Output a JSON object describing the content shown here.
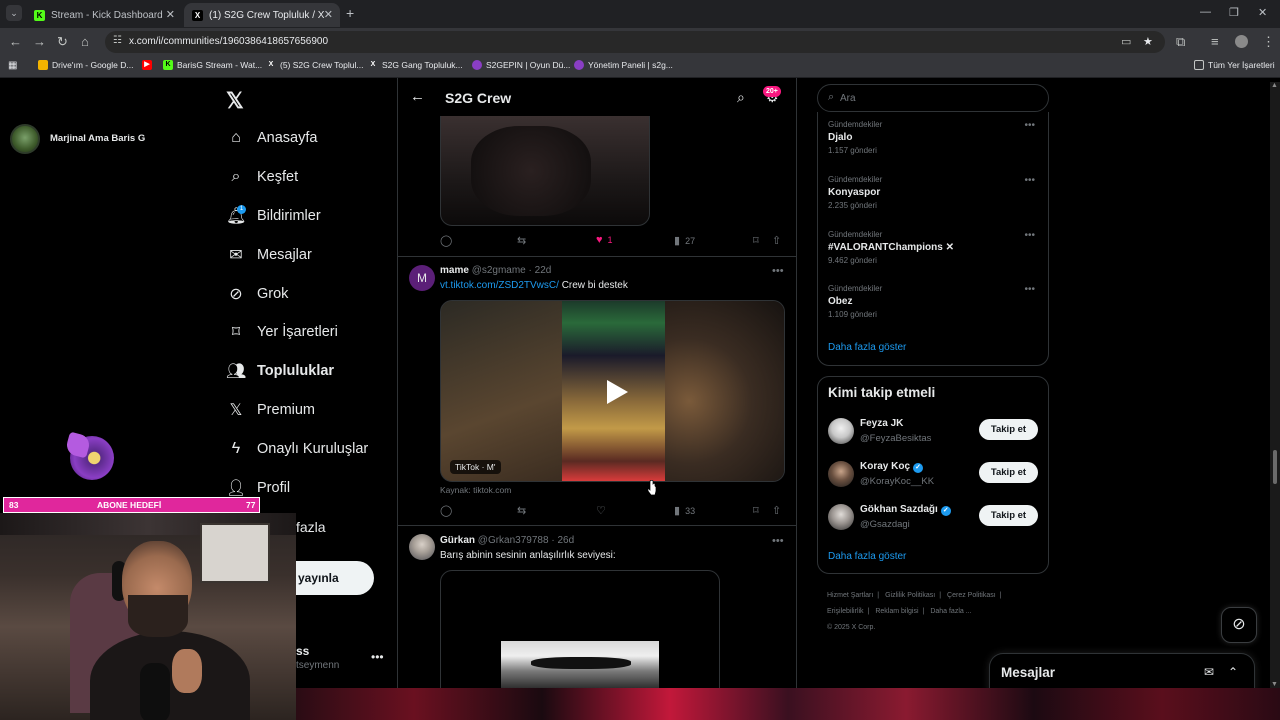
{
  "browser": {
    "tabs": [
      {
        "title": "Stream - Kick Dashboard",
        "favicon": "kick-icon",
        "active": false
      },
      {
        "title": "(1) S2G Crew Topluluk / X",
        "favicon": "x-icon",
        "active": true
      }
    ],
    "url": "x.com/i/communities/1960386418657656900",
    "bookmarks": [
      {
        "label": "Drive'ım - Google D...",
        "icon": "google-drive-icon"
      },
      {
        "label": "",
        "icon": "youtube-icon"
      },
      {
        "label": "BarisG Stream - Wat...",
        "icon": "kick-icon"
      },
      {
        "label": "(5) S2G Crew Toplul...",
        "icon": "x-icon"
      },
      {
        "label": "S2G Gang Topluluk...",
        "icon": "x-icon"
      },
      {
        "label": "S2GEPIN | Oyun Dü...",
        "icon": "s2g-icon"
      },
      {
        "label": "Yönetim Paneli | s2g...",
        "icon": "s2g-icon"
      }
    ],
    "all_bookmarks": "Tüm Yer İşaretleri"
  },
  "profile": {
    "name": "Marjinal Ama Baris G"
  },
  "nav": {
    "items": [
      {
        "label": "Anasayfa",
        "icon": "home-icon",
        "active": false
      },
      {
        "label": "Keşfet",
        "icon": "search-icon",
        "active": false
      },
      {
        "label": "Bildirimler",
        "icon": "bell-icon",
        "active": false,
        "badge": "1"
      },
      {
        "label": "Mesajlar",
        "icon": "mail-icon",
        "active": false
      },
      {
        "label": "Grok",
        "icon": "grok-icon",
        "active": false
      },
      {
        "label": "Yer İşaretleri",
        "icon": "bookmark-icon",
        "active": false
      },
      {
        "label": "Topluluklar",
        "icon": "communities-icon",
        "active": true
      },
      {
        "label": "Premium",
        "icon": "x-icon",
        "active": false
      },
      {
        "label": "Onaylı Kuruluşlar",
        "icon": "lightning-icon",
        "active": false
      },
      {
        "label": "Profil",
        "icon": "person-icon",
        "active": false
      }
    ],
    "more": "fazla",
    "post_button": "yayınla",
    "account_name": "ss",
    "account_handle": "tseymenn"
  },
  "stream": {
    "sub_goal_label": "ABONE HEDEFİ",
    "sub_goal_current": "83",
    "sub_goal_target": "77"
  },
  "feed": {
    "title": "S2G Crew",
    "notif_badge": "20+",
    "post1_actions": {
      "likes": "1",
      "views": "27"
    },
    "post2": {
      "author": "mame",
      "handle": "@s2gmame",
      "time": "22d",
      "avatar_letter": "M",
      "link": "vt.tiktok.com/ZSD2TVwsC/",
      "text": "Crew bi destek",
      "video_label": "TikTok · M'",
      "source": "Kaynak: tiktok.com",
      "views": "33"
    },
    "post3": {
      "author": "Gürkan",
      "handle": "@Grkan379788",
      "time": "26d",
      "text": "Barış abinin sesinin anlaşılırlık seviyesi:"
    }
  },
  "sidebar": {
    "search_placeholder": "Ara",
    "trends": [
      {
        "category": "Gündemdekiler",
        "name": "Djalo",
        "count": "1.157 gönderi"
      },
      {
        "category": "Gündemdekiler",
        "name": "Konyaspor",
        "count": "2.235 gönderi"
      },
      {
        "category": "Gündemdekiler",
        "name": "#VALORANTChampions",
        "count": "9.462 gönderi"
      },
      {
        "category": "Gündemdekiler",
        "name": "Obez",
        "count": "1.109 gönderi"
      }
    ],
    "trends_more": "Daha fazla göster",
    "who_to_follow_title": "Kimi takip etmeli",
    "follow_users": [
      {
        "name": "Feyza JK",
        "handle": "@FeyzaBesiktas",
        "verified": false,
        "button": "Takip et"
      },
      {
        "name": "Koray Koç",
        "handle": "@KorayKoc__KK",
        "verified": true,
        "button": "Takip et"
      },
      {
        "name": "Gökhan Sazdağı",
        "handle": "@Gsazdagi",
        "verified": true,
        "button": "Takip et"
      }
    ],
    "follow_more": "Daha fazla göster",
    "footer_links": [
      "Hizmet Şartları",
      "Gizlilik Politikası",
      "Çerez Politikası",
      "Erişilebilirlik",
      "Reklam bilgisi",
      "Daha fazla ..."
    ],
    "copyright": "© 2025 X Corp."
  },
  "dm": {
    "title": "Mesajlar"
  }
}
